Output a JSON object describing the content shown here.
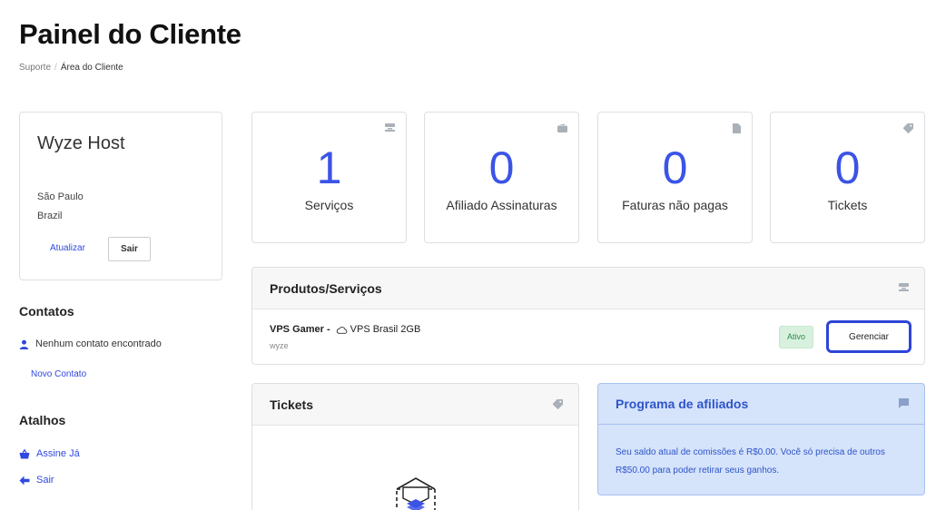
{
  "page": {
    "title": "Painel do Cliente",
    "breadcrumb": [
      "Suporte",
      "Área do Cliente"
    ]
  },
  "client": {
    "name": "Wyze Host",
    "city": "São Paulo",
    "country": "Brazil",
    "update_label": "Atualizar",
    "logout_label": "Sair"
  },
  "contacts": {
    "title": "Contatos",
    "empty_text": "Nenhum contato encontrado",
    "new_label": "Novo Contato"
  },
  "shortcuts": {
    "title": "Atalhos",
    "items": [
      {
        "label": "Assine Já",
        "icon": "basket-icon"
      },
      {
        "label": "Sair",
        "icon": "arrow-left-icon"
      }
    ]
  },
  "stats": [
    {
      "value": "1",
      "label": "Serviços",
      "icon": "server-icon"
    },
    {
      "value": "0",
      "label": "Afiliado Assinaturas",
      "icon": "wallet-icon"
    },
    {
      "value": "0",
      "label": "Faturas não pagas",
      "icon": "file-icon"
    },
    {
      "value": "0",
      "label": "Tickets",
      "icon": "tag-icon"
    }
  ],
  "products": {
    "title": "Produtos/Serviços",
    "items": [
      {
        "name": "VPS Gamer -",
        "plan": "VPS Brasil 2GB",
        "domain": "wyze",
        "status": "Ativo",
        "action": "Gerenciar"
      }
    ]
  },
  "tickets": {
    "title": "Tickets"
  },
  "affiliate": {
    "title": "Programa de afiliados",
    "text": "Seu saldo atual de comissões é R$0.00. Você só precisa de outros R$50.00 para poder retirar seus ganhos."
  },
  "colors": {
    "accent": "#3b54e6",
    "link": "#2f48e0",
    "status_active_bg": "#d8f1df",
    "affiliate_bg": "#d5e3fb"
  }
}
